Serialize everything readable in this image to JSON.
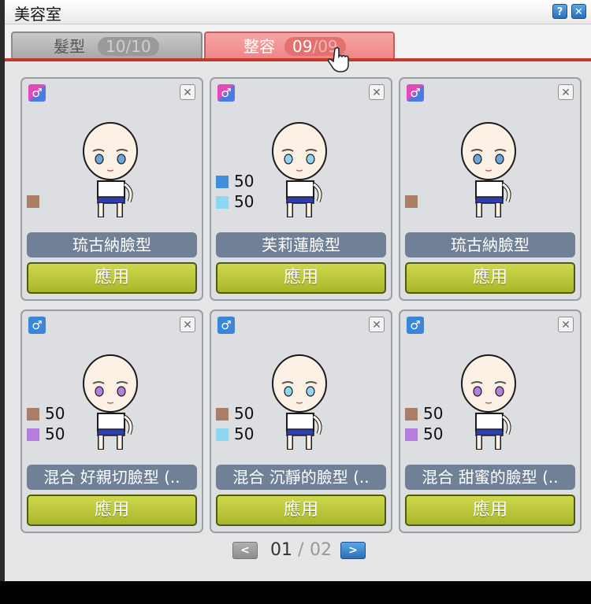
{
  "window": {
    "title": "美容室"
  },
  "tabs": [
    {
      "label": "髮型",
      "count": "10/10"
    },
    {
      "label": "整容",
      "count_current": "09",
      "count_sep": "/",
      "count_total": "09"
    }
  ],
  "cards": [
    {
      "name": "琉古納臉型",
      "gender": "both",
      "colors": [
        {
          "hex": "#a97e64",
          "pct": ""
        }
      ],
      "apply_label": "應用"
    },
    {
      "name": "芙莉蓮臉型",
      "gender": "both",
      "colors": [
        {
          "hex": "#3f8fdd",
          "pct": "50"
        },
        {
          "hex": "#8ed7f3",
          "pct": "50"
        }
      ],
      "apply_label": "應用"
    },
    {
      "name": "琉古納臉型",
      "gender": "both",
      "colors": [
        {
          "hex": "#a97e64",
          "pct": ""
        }
      ],
      "apply_label": "應用"
    },
    {
      "name": "混合 好親切臉型 (..",
      "gender": "male",
      "colors": [
        {
          "hex": "#a97e64",
          "pct": "50"
        },
        {
          "hex": "#b57ede",
          "pct": "50"
        }
      ],
      "apply_label": "應用"
    },
    {
      "name": "混合 沉靜的臉型 (..",
      "gender": "male",
      "colors": [
        {
          "hex": "#a97e64",
          "pct": "50"
        },
        {
          "hex": "#8ed7f3",
          "pct": "50"
        }
      ],
      "apply_label": "應用"
    },
    {
      "name": "混合 甜蜜的臉型 (..",
      "gender": "male",
      "colors": [
        {
          "hex": "#a97e64",
          "pct": "50"
        },
        {
          "hex": "#b57ede",
          "pct": "50"
        }
      ],
      "apply_label": "應用"
    }
  ],
  "pager": {
    "current": "01",
    "separator": "/",
    "total": "02"
  }
}
